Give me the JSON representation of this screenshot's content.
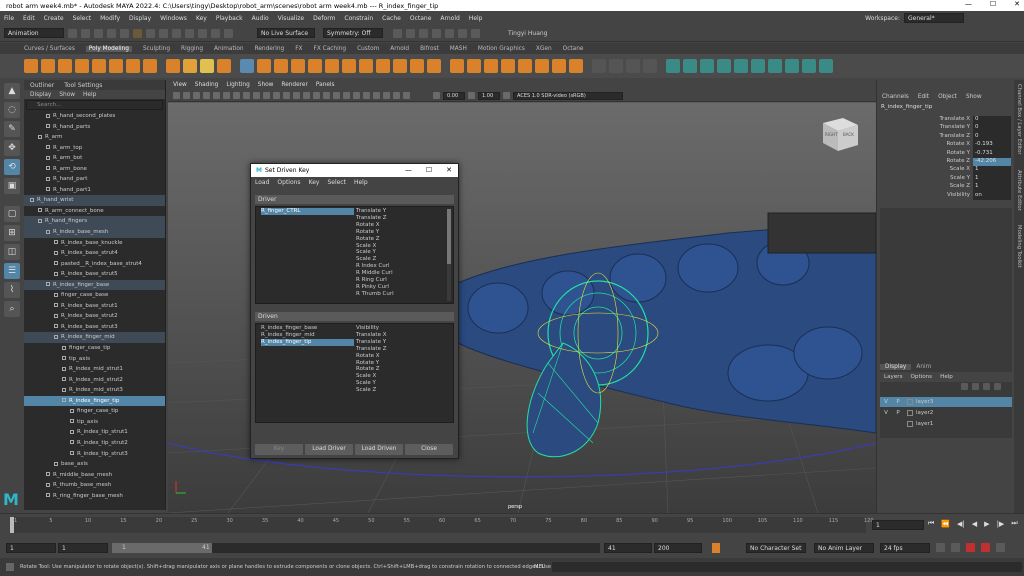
{
  "title": "robot arm week4.mb* - Autodesk MAYA 2022.4: C:\\Users\\tingy\\Desktop\\robot_arm\\scenes\\robot arm week4.mb  ---  R_index_finger_tip",
  "window_controls": [
    "—",
    "☐",
    "✕"
  ],
  "menubar": [
    "File",
    "Edit",
    "Create",
    "Select",
    "Modify",
    "Display",
    "Windows",
    "Key",
    "Playback",
    "Audio",
    "Visualize",
    "Deform",
    "Constrain",
    "Cache",
    "Octane",
    "Arnold",
    "Help"
  ],
  "workspace": {
    "label": "Workspace:",
    "value": "General*"
  },
  "statusline": {
    "mode": "Animation",
    "live_surface": "No Live Surface",
    "symmetry": "Symmetry: Off",
    "user": "Tingyi Huang"
  },
  "shelf_tabs": [
    "Curves / Surfaces",
    "Poly Modeling",
    "Sculpting",
    "Rigging",
    "Animation",
    "Rendering",
    "FX",
    "FX Caching",
    "Custom",
    "Arnold",
    "Bifrost",
    "MASH",
    "Motion Graphics",
    "XGen",
    "Octane"
  ],
  "shelf_active": "Poly Modeling",
  "outliner": {
    "tabs": [
      "Outliner",
      "Tool Settings"
    ],
    "menu": [
      "Display",
      "Show",
      "Help"
    ],
    "search_placeholder": "Search...",
    "items": [
      {
        "label": "R_hand_second_plates",
        "indent": 2,
        "state": ""
      },
      {
        "label": "R_hand_parts",
        "indent": 2,
        "state": ""
      },
      {
        "label": "R_arm",
        "indent": 1,
        "state": ""
      },
      {
        "label": "R_arm_top",
        "indent": 2,
        "state": ""
      },
      {
        "label": "R_arm_bot",
        "indent": 2,
        "state": ""
      },
      {
        "label": "R_arm_bone",
        "indent": 2,
        "state": ""
      },
      {
        "label": "R_hand_part",
        "indent": 2,
        "state": ""
      },
      {
        "label": "R_hand_part1",
        "indent": 2,
        "state": ""
      },
      {
        "label": "R_hand_wrist",
        "indent": 0,
        "state": "hl"
      },
      {
        "label": "R_arm_connect_bone",
        "indent": 1,
        "state": ""
      },
      {
        "label": "R_hand_fingers",
        "indent": 1,
        "state": "hl"
      },
      {
        "label": "R_index_base_mesh",
        "indent": 2,
        "state": "hl"
      },
      {
        "label": "R_index_base_knuckle",
        "indent": 3,
        "state": ""
      },
      {
        "label": "R_index_base_strut4",
        "indent": 3,
        "state": ""
      },
      {
        "label": "pasted__R_index_base_strut4",
        "indent": 3,
        "state": ""
      },
      {
        "label": "R_index_base_strut5",
        "indent": 3,
        "state": ""
      },
      {
        "label": "R_index_finger_base",
        "indent": 2,
        "state": "hl"
      },
      {
        "label": "finger_case_base",
        "indent": 3,
        "state": ""
      },
      {
        "label": "R_index_base_strut1",
        "indent": 3,
        "state": ""
      },
      {
        "label": "R_index_base_strut2",
        "indent": 3,
        "state": ""
      },
      {
        "label": "R_index_base_strut3",
        "indent": 3,
        "state": ""
      },
      {
        "label": "R_index_finger_mid",
        "indent": 3,
        "state": "hl"
      },
      {
        "label": "finger_case_tip",
        "indent": 4,
        "state": ""
      },
      {
        "label": "tip_axis",
        "indent": 4,
        "state": ""
      },
      {
        "label": "R_index_mid_strut1",
        "indent": 4,
        "state": ""
      },
      {
        "label": "R_index_mid_strut2",
        "indent": 4,
        "state": ""
      },
      {
        "label": "R_index_mid_strut3",
        "indent": 4,
        "state": ""
      },
      {
        "label": "R_index_finger_tip",
        "indent": 4,
        "state": "sel"
      },
      {
        "label": "finger_case_tip",
        "indent": 5,
        "state": ""
      },
      {
        "label": "tip_axis",
        "indent": 5,
        "state": ""
      },
      {
        "label": "R_index_tip_strut1",
        "indent": 5,
        "state": ""
      },
      {
        "label": "R_index_tip_strut2",
        "indent": 5,
        "state": ""
      },
      {
        "label": "R_index_tip_strut3",
        "indent": 5,
        "state": ""
      },
      {
        "label": "base_axis",
        "indent": 3,
        "state": ""
      },
      {
        "label": "R_middle_base_mesh",
        "indent": 2,
        "state": ""
      },
      {
        "label": "R_thumb_base_mesh",
        "indent": 2,
        "state": ""
      },
      {
        "label": "R_ring_finger_base_mesh",
        "indent": 2,
        "state": ""
      }
    ]
  },
  "viewport": {
    "menu": [
      "View",
      "Shading",
      "Lighting",
      "Show",
      "Renderer",
      "Panels"
    ],
    "exposure": "0.00",
    "gamma": "1.00",
    "colorspace": "ACES 1.0 SDR-video (sRGB)",
    "camera": "persp",
    "cube_labels": [
      "RIGHT",
      "BACK"
    ]
  },
  "dialog": {
    "title": "Set Driven Key",
    "menu": [
      "Load",
      "Options",
      "Key",
      "Select",
      "Help"
    ],
    "driver_header": "Driver",
    "driver_objects": [
      "R_finger_CTRL"
    ],
    "driver_attrs": [
      "Translate Y",
      "Translate Z",
      "Rotate X",
      "Rotate Y",
      "Rotate Z",
      "Scale X",
      "Scale Y",
      "Scale Z",
      "R Index Curl",
      "R Middle Curl",
      "R Ring Curl",
      "R Pinky Curl",
      "R Thumb Curl"
    ],
    "driven_header": "Driven",
    "driven_objects": [
      "R_index_finger_base",
      "R_index_finger_mid",
      "R_index_finger_tip"
    ],
    "driven_attrs": [
      "Visibility",
      "Translate X",
      "Translate Y",
      "Translate Z",
      "Rotate X",
      "Rotate Y",
      "Rotate Z",
      "Scale X",
      "Scale Y",
      "Scale Z"
    ],
    "buttons": [
      "Key",
      "Load Driver",
      "Load Driven",
      "Close"
    ]
  },
  "channelbox": {
    "menu": [
      "Channels",
      "Edit",
      "Object",
      "Show"
    ],
    "object": "R_index_finger_tip",
    "channels": [
      {
        "name": "Translate X",
        "value": "0"
      },
      {
        "name": "Translate Y",
        "value": "0"
      },
      {
        "name": "Translate Z",
        "value": "0"
      },
      {
        "name": "Rotate X",
        "value": "-0.193"
      },
      {
        "name": "Rotate Y",
        "value": "-0.731"
      },
      {
        "name": "Rotate Z",
        "value": "-42.206"
      },
      {
        "name": "Scale X",
        "value": "1"
      },
      {
        "name": "Scale Y",
        "value": "1"
      },
      {
        "name": "Scale Z",
        "value": "1"
      },
      {
        "name": "Visibility",
        "value": "on"
      }
    ],
    "layer_tabs": [
      "Display",
      "Anim"
    ],
    "layer_menu": [
      "Layers",
      "Options",
      "Help"
    ],
    "layers": [
      {
        "v": "V",
        "p": "P",
        "name": "layer3",
        "selected": true
      },
      {
        "v": "V",
        "p": "P",
        "name": "layer2",
        "selected": false
      },
      {
        "v": "",
        "p": "",
        "name": "layer1",
        "selected": false
      }
    ],
    "side_tabs": [
      "Channel Box / Layer Editor",
      "Attribute Editor",
      "Modeling Toolkit"
    ]
  },
  "timeline": {
    "ticks": [
      "1",
      "5",
      "10",
      "15",
      "20",
      "25",
      "30",
      "35",
      "40",
      "45",
      "50",
      "55",
      "60",
      "65",
      "70",
      "75",
      "80",
      "85",
      "90",
      "95",
      "100",
      "105",
      "110",
      "115",
      "120"
    ],
    "current_frame": "1"
  },
  "range": {
    "start": "1",
    "start2": "1",
    "slider_start": "1",
    "slider_end": "41",
    "end": "41",
    "anim_end": "200",
    "char_set": "No Character Set",
    "anim_layer": "No Anim Layer",
    "fps": "24 fps"
  },
  "helpline": {
    "label": "MEL",
    "text": "Rotate Tool: Use manipulator to rotate object(s). Shift+drag manipulator axis or plane handles to extrude components or clone objects. Ctrl+Shift+LMB+drag to constrain rotation to connected edges. Use D or INSE"
  },
  "colors": {
    "selection": "#5285a6",
    "robot": "#26457a",
    "ctrl": "#22e0a0"
  }
}
